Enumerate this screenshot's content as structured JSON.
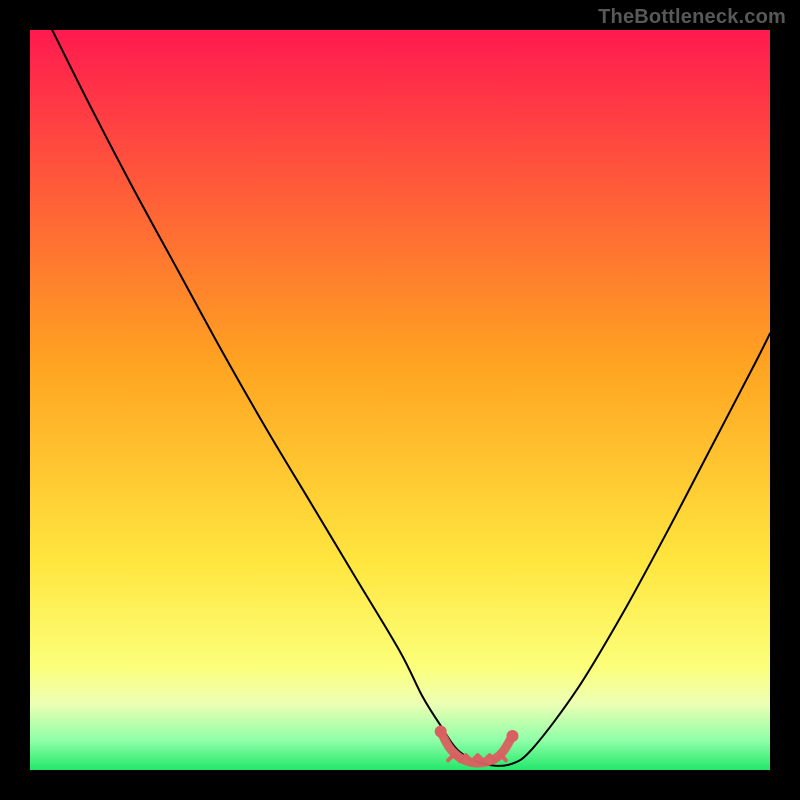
{
  "watermark": "TheBottleneck.com",
  "chart_data": {
    "type": "line",
    "title": "",
    "xlabel": "",
    "ylabel": "",
    "xlim": [
      0,
      100
    ],
    "ylim": [
      0,
      100
    ],
    "background_gradient_stops": [
      {
        "offset": 0.0,
        "color": "#ff1a4f"
      },
      {
        "offset": 0.45,
        "color": "#ffa321"
      },
      {
        "offset": 0.72,
        "color": "#ffe63f"
      },
      {
        "offset": 0.86,
        "color": "#fcff7a"
      },
      {
        "offset": 0.91,
        "color": "#edffb4"
      },
      {
        "offset": 0.96,
        "color": "#8fffa8"
      },
      {
        "offset": 1.0,
        "color": "#22e86a"
      }
    ],
    "series": [
      {
        "name": "curve",
        "color": "#000000",
        "x": [
          3,
          8,
          14,
          20,
          26,
          32,
          38,
          44,
          50,
          53,
          55.5,
          58,
          61.5,
          65,
          68,
          74,
          80,
          86,
          92,
          98,
          100
        ],
        "y": [
          100,
          90,
          78.5,
          67.5,
          56.5,
          46,
          36,
          26,
          16,
          10,
          6,
          2.5,
          0.8,
          0.8,
          3,
          11,
          21,
          32,
          43.5,
          55,
          59
        ]
      }
    ],
    "low_marker": {
      "color": "#d96060",
      "x": [
        55.5,
        56.7,
        58.2,
        59.8,
        61.2,
        62.8,
        64.0,
        65.2
      ],
      "y": [
        5.2,
        3.0,
        1.6,
        1.0,
        1.0,
        1.5,
        2.6,
        4.6
      ],
      "baseline_joggle": [
        {
          "x": 56.5,
          "y": 1.3
        },
        {
          "x": 57.3,
          "y": 2.1
        },
        {
          "x": 58.1,
          "y": 1.2
        },
        {
          "x": 58.9,
          "y": 2.0
        },
        {
          "x": 59.7,
          "y": 1.2
        },
        {
          "x": 60.5,
          "y": 2.0
        },
        {
          "x": 61.3,
          "y": 1.2
        },
        {
          "x": 62.1,
          "y": 2.0
        },
        {
          "x": 62.9,
          "y": 1.2
        },
        {
          "x": 63.7,
          "y": 2.0
        },
        {
          "x": 64.3,
          "y": 1.3
        }
      ]
    }
  }
}
